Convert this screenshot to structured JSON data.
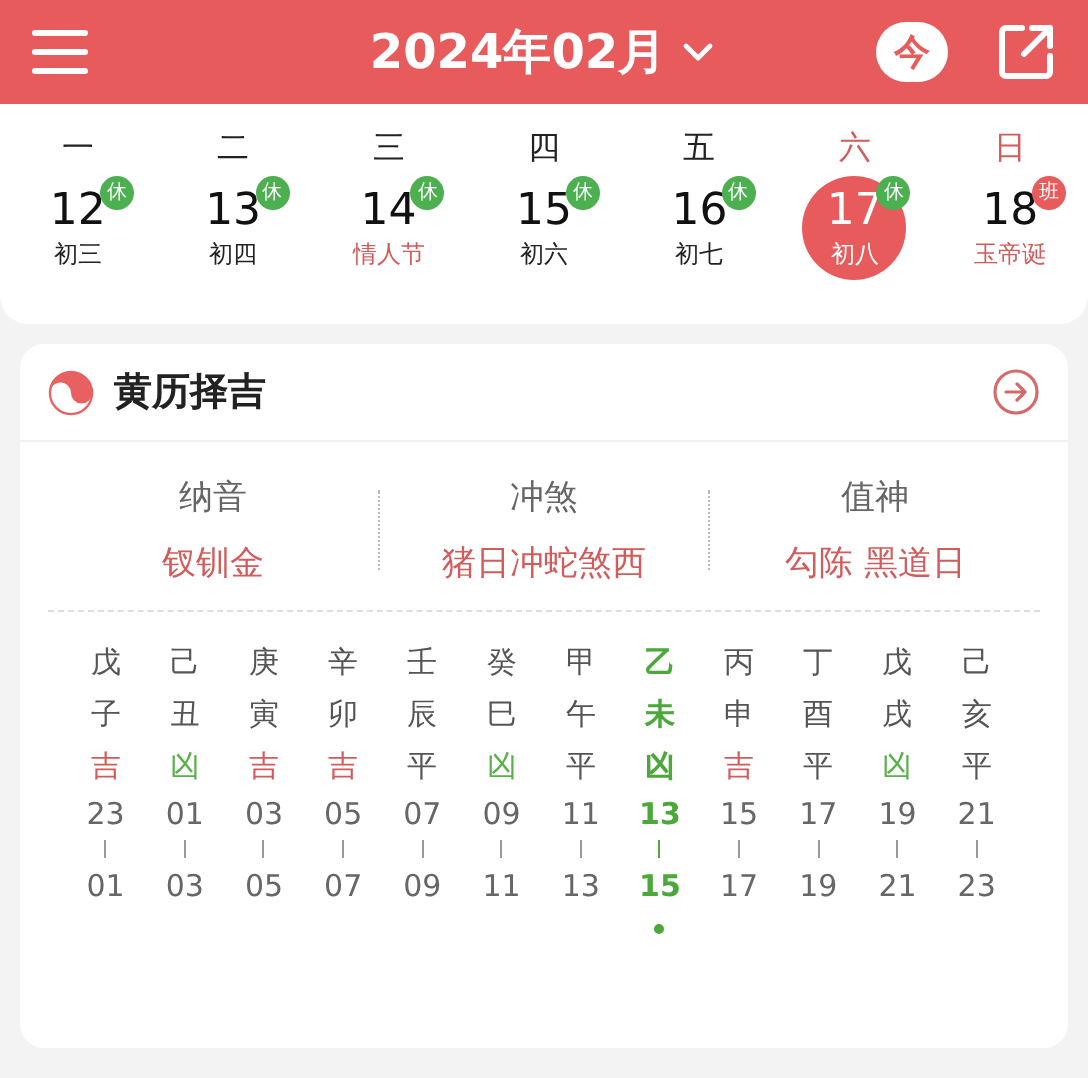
{
  "header": {
    "title": "2024年02月",
    "today_button": "今"
  },
  "week": [
    {
      "weekday": "一",
      "day": "12",
      "badge": {
        "text": "休",
        "kind": "rest"
      },
      "lunar": "初三",
      "weekend": false,
      "festival": false,
      "selected": false
    },
    {
      "weekday": "二",
      "day": "13",
      "badge": {
        "text": "休",
        "kind": "rest"
      },
      "lunar": "初四",
      "weekend": false,
      "festival": false,
      "selected": false
    },
    {
      "weekday": "三",
      "day": "14",
      "badge": {
        "text": "休",
        "kind": "rest"
      },
      "lunar": "情人节",
      "weekend": false,
      "festival": true,
      "selected": false
    },
    {
      "weekday": "四",
      "day": "15",
      "badge": {
        "text": "休",
        "kind": "rest"
      },
      "lunar": "初六",
      "weekend": false,
      "festival": false,
      "selected": false
    },
    {
      "weekday": "五",
      "day": "16",
      "badge": {
        "text": "休",
        "kind": "rest"
      },
      "lunar": "初七",
      "weekend": false,
      "festival": false,
      "selected": false
    },
    {
      "weekday": "六",
      "day": "17",
      "badge": {
        "text": "休",
        "kind": "rest"
      },
      "lunar": "初八",
      "weekend": true,
      "festival": false,
      "selected": true
    },
    {
      "weekday": "日",
      "day": "18",
      "badge": {
        "text": "班",
        "kind": "work"
      },
      "lunar": "玉帝诞",
      "weekend": true,
      "festival": true,
      "selected": false
    }
  ],
  "almanac": {
    "title": "黄历择吉",
    "info": [
      {
        "label": "纳音",
        "value": "钗钏金"
      },
      {
        "label": "冲煞",
        "value": "猪日冲蛇煞西"
      },
      {
        "label": "值神",
        "value": "勾陈 黑道日"
      }
    ],
    "hours": [
      {
        "stem": "戊",
        "branch": "子",
        "kind": "good",
        "luck": "吉",
        "start": "23",
        "end": "01",
        "current": false
      },
      {
        "stem": "己",
        "branch": "丑",
        "kind": "bad",
        "luck": "凶",
        "start": "01",
        "end": "03",
        "current": false
      },
      {
        "stem": "庚",
        "branch": "寅",
        "kind": "good",
        "luck": "吉",
        "start": "03",
        "end": "05",
        "current": false
      },
      {
        "stem": "辛",
        "branch": "卯",
        "kind": "good",
        "luck": "吉",
        "start": "05",
        "end": "07",
        "current": false
      },
      {
        "stem": "壬",
        "branch": "辰",
        "kind": "neutral",
        "luck": "平",
        "start": "07",
        "end": "09",
        "current": false
      },
      {
        "stem": "癸",
        "branch": "巳",
        "kind": "bad",
        "luck": "凶",
        "start": "09",
        "end": "11",
        "current": false
      },
      {
        "stem": "甲",
        "branch": "午",
        "kind": "neutral",
        "luck": "平",
        "start": "11",
        "end": "13",
        "current": false
      },
      {
        "stem": "乙",
        "branch": "未",
        "kind": "bad",
        "luck": "凶",
        "start": "13",
        "end": "15",
        "current": true
      },
      {
        "stem": "丙",
        "branch": "申",
        "kind": "good",
        "luck": "吉",
        "start": "15",
        "end": "17",
        "current": false
      },
      {
        "stem": "丁",
        "branch": "酉",
        "kind": "neutral",
        "luck": "平",
        "start": "17",
        "end": "19",
        "current": false
      },
      {
        "stem": "戊",
        "branch": "戌",
        "kind": "bad",
        "luck": "凶",
        "start": "19",
        "end": "21",
        "current": false
      },
      {
        "stem": "己",
        "branch": "亥",
        "kind": "neutral",
        "luck": "平",
        "start": "21",
        "end": "23",
        "current": false
      }
    ]
  }
}
